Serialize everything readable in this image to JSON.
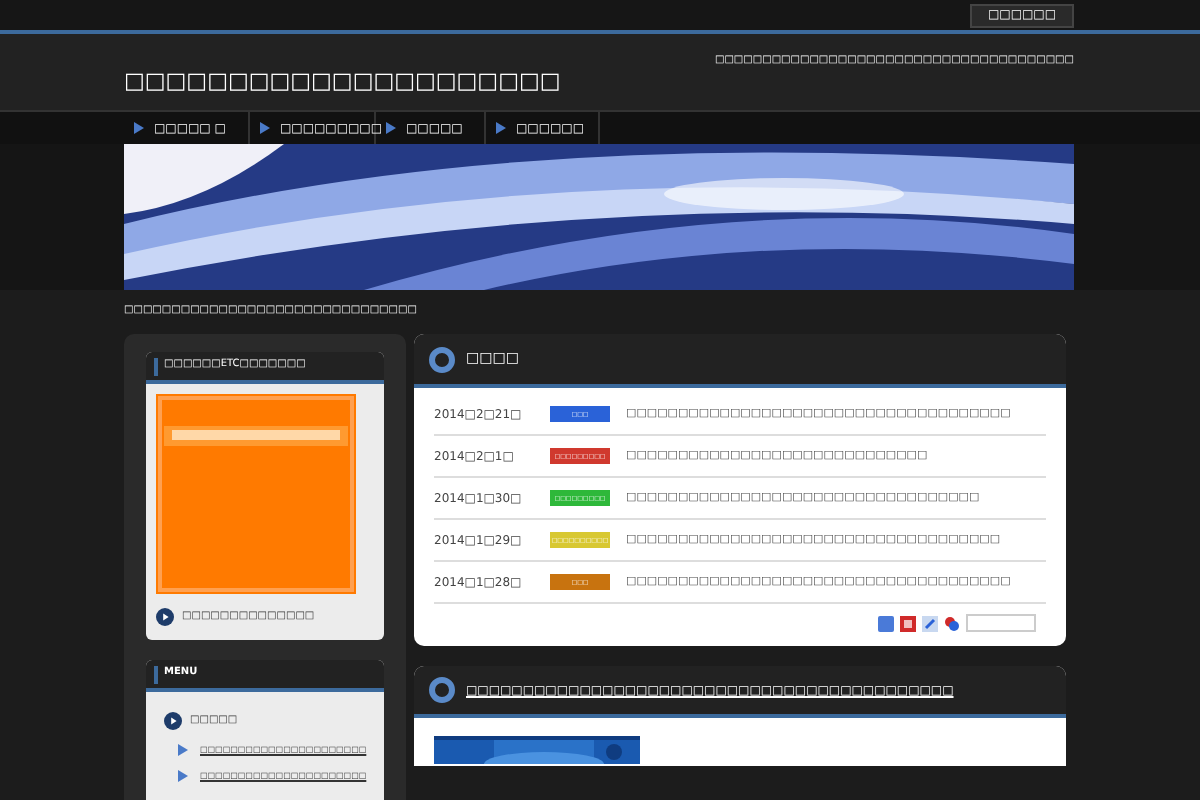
{
  "top_button": "□□□□□□",
  "site_title": "□□□□□□□□□□□□□□□□□□□□□",
  "tagline": "□□□□□□□□□□□□□□□□□□□□□□□□□□□□□□□□□□□□□□",
  "nav": [
    {
      "label": "□□□□□ □"
    },
    {
      "label": "□□□□□□□□□"
    },
    {
      "label": "□□□□□"
    },
    {
      "label": "□□□□□□"
    }
  ],
  "breadcrumb": "□□□□□□□□□□□□□□□□□□□□□□□□□□□□□□□",
  "sidebar": {
    "widget": {
      "title": "□□□□□□ETC□□□□□□□",
      "link": "□□□□□□□□□□□□□□"
    },
    "menu": {
      "title": "MENU",
      "item": "□□□□□",
      "children": [
        {
          "label": "□□□□□□□□□□□□□□□□□□□□□□"
        },
        {
          "label": "□□□□□□□□□□□□□□□□□□□□□□"
        }
      ]
    }
  },
  "news": {
    "title": "□□□□",
    "rows": [
      {
        "date": "2014□2□21□",
        "tag": "□□□",
        "color": "#2a62d8",
        "text": "□□□□□□□□□□□□□□□□□□□□□□□□□□□□□□□□□□□□□"
      },
      {
        "date": "2014□2□1□",
        "tag": "□□□□□□□□□",
        "color": "#d0392e",
        "text": "□□□□□□□□□□□□□□□□□□□□□□□□□□□□□"
      },
      {
        "date": "2014□1□30□",
        "tag": "□□□□□□□□□",
        "color": "#2eb83a",
        "text": "□□□□□□□□□□□□□□□□□□□□□□□□□□□□□□□□□□"
      },
      {
        "date": "2014□1□29□",
        "tag": "□□□□□□□□□□",
        "color": "#d8c832",
        "text": "□□□□□□□□□□□□□□□□□□□□□□□□□□□□□□□□□□□□"
      },
      {
        "date": "2014□1□28□",
        "tag": "□□□",
        "color": "#c8730f",
        "text": "□□□□□□□□□□□□□□□□□□□□□□□□□□□□□□□□□□□□□"
      }
    ]
  },
  "article": {
    "title": "□□□□□□□□□□□□□□□□□□□□□□□□□□□□□□□□□□□□□□□□□□□"
  }
}
